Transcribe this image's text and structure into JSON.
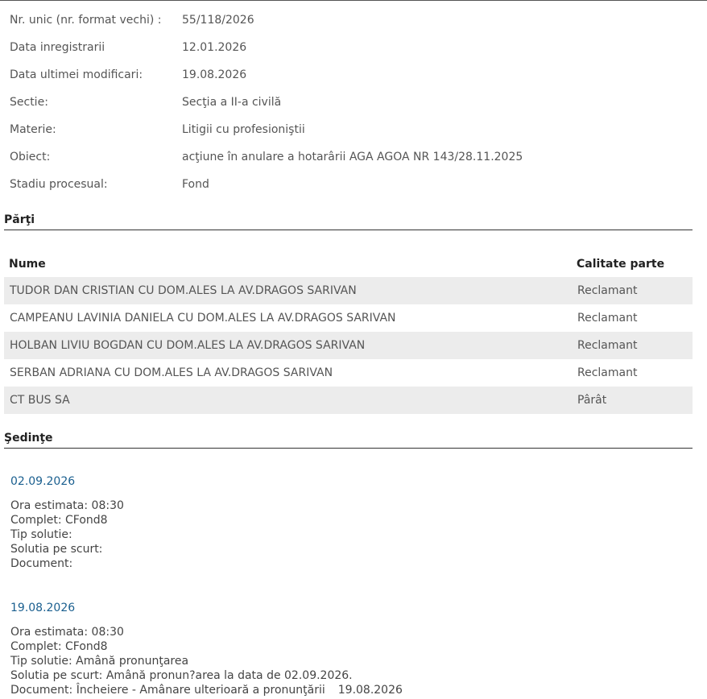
{
  "info": [
    {
      "label": "Nr. unic (nr. format vechi) :",
      "value": "55/118/2026"
    },
    {
      "label": "Data inregistrarii",
      "value": "12.01.2026"
    },
    {
      "label": "Data ultimei modificari:",
      "value": "19.08.2026"
    },
    {
      "label": "Sectie:",
      "value": "Secţia a II-a civilă"
    },
    {
      "label": "Materie:",
      "value": "Litigii cu profesioniştii"
    },
    {
      "label": "Obiect:",
      "value": "acţiune în anulare a hotarârii AGA AGOA NR 143/28.11.2025"
    },
    {
      "label": "Stadiu procesual:",
      "value": "Fond"
    }
  ],
  "parti": {
    "title": "Părţi",
    "headers": {
      "nume": "Nume",
      "calitate": "Calitate parte"
    },
    "rows": [
      {
        "nume": "TUDOR DAN CRISTIAN CU DOM.ALES LA AV.DRAGOS SARIVAN",
        "calitate": "Reclamant"
      },
      {
        "nume": "CAMPEANU LAVINIA DANIELA CU DOM.ALES LA AV.DRAGOS SARIVAN",
        "calitate": "Reclamant"
      },
      {
        "nume": "HOLBAN LIVIU BOGDAN CU DOM.ALES LA AV.DRAGOS SARIVAN",
        "calitate": "Reclamant"
      },
      {
        "nume": "SERBAN ADRIANA CU DOM.ALES LA AV.DRAGOS SARIVAN",
        "calitate": "Reclamant"
      },
      {
        "nume": "CT BUS SA",
        "calitate": "Pârât"
      }
    ]
  },
  "sedinte": {
    "title": "Şedinţe",
    "items": [
      {
        "date": "02.09.2026",
        "ora": "Ora estimata: 08:30",
        "complet": "Complet: CFond8",
        "tip_solutie": "Tip solutie:",
        "solutia": "Solutia pe scurt:",
        "document": "Document:",
        "document_date": ""
      },
      {
        "date": "19.08.2026",
        "ora": "Ora estimata: 08:30",
        "complet": "Complet: CFond8",
        "tip_solutie": "Tip solutie: Amână pronunţarea",
        "solutia": "Solutia pe scurt: Amână pronun?area la data de 02.09.2026.",
        "document": "Document: Încheiere - Amânare ulterioară a pronunţării",
        "document_date": "19.08.2026"
      }
    ]
  }
}
